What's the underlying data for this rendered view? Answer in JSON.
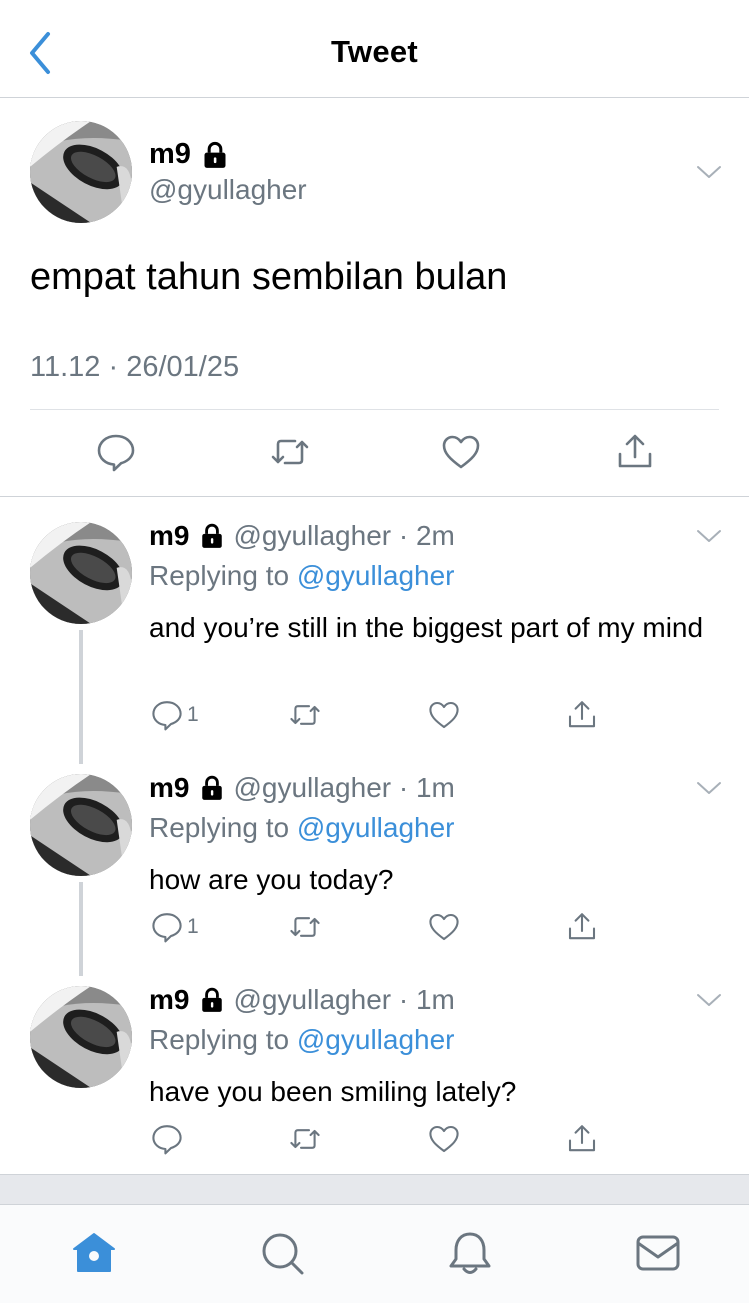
{
  "header": {
    "title": "Tweet"
  },
  "main_tweet": {
    "name": "m9",
    "handle": "@gyullagher",
    "text": "empat tahun sembilan bulan",
    "timestamp": "11.12 · 26/01/25"
  },
  "replies": [
    {
      "name": "m9",
      "meta": "@gyullagher · 2m",
      "replying_prefix": "Replying to",
      "mention": "@gyullagher",
      "text": "and you’re still in the biggest part of my mind",
      "reply_count": "1"
    },
    {
      "name": "m9",
      "meta": "@gyullagher · 1m",
      "replying_prefix": "Replying to",
      "mention": "@gyullagher",
      "text": "how are you today?",
      "reply_count": "1"
    },
    {
      "name": "m9",
      "meta": "@gyullagher · 1m",
      "replying_prefix": "Replying to",
      "mention": "@gyullagher",
      "text": "have you been smiling lately?",
      "reply_count": ""
    }
  ],
  "icons": {
    "back": "chevron-left-icon",
    "lock": "lock-icon",
    "more": "chevron-down-icon",
    "reply": "comment-icon",
    "retweet": "retweet-icon",
    "like": "heart-icon",
    "share": "share-icon",
    "tabs": [
      "home-icon",
      "search-icon",
      "notifications-icon",
      "messages-icon"
    ]
  },
  "colors": {
    "accent": "#3b8fd9",
    "muted": "#6b7680",
    "divider": "#cfd3d8"
  }
}
